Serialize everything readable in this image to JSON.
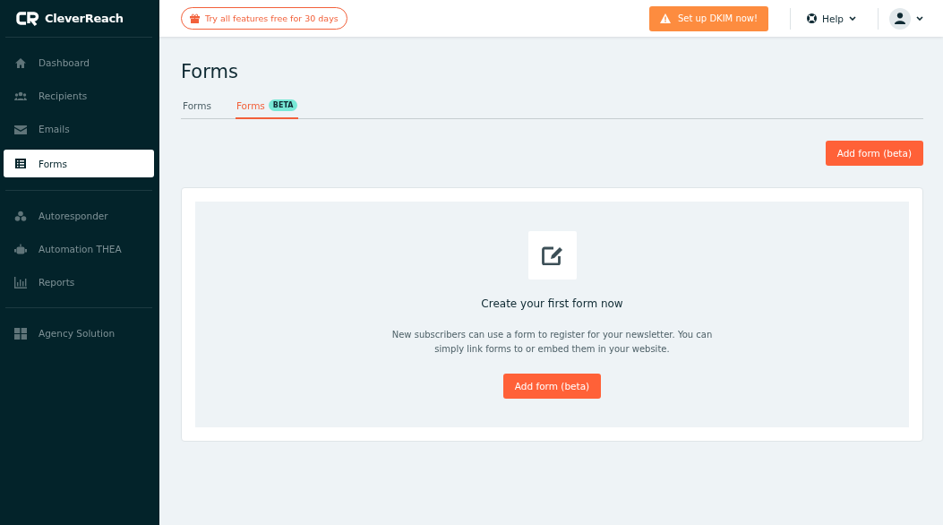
{
  "logo": {
    "text": "CleverReach"
  },
  "sidebar": {
    "groups": [
      [
        {
          "label": "Dashboard",
          "selected": false
        },
        {
          "label": "Recipients",
          "selected": false
        },
        {
          "label": "Emails",
          "selected": false
        },
        {
          "label": "Forms",
          "selected": true
        }
      ],
      [
        {
          "label": "Autoresponder",
          "selected": false
        },
        {
          "label": "Automation THEA",
          "selected": false
        },
        {
          "label": "Reports",
          "selected": false
        }
      ],
      [
        {
          "label": "Agency Solution",
          "selected": false
        }
      ]
    ]
  },
  "topbar": {
    "trial": "Try all features free for 30 days",
    "dkim": "Set up DKIM now!",
    "help": "Help"
  },
  "page": {
    "title": "Forms",
    "tabs": [
      {
        "label": "Forms",
        "selected": false
      },
      {
        "label": "Forms",
        "badge": "BETA",
        "selected": true
      }
    ],
    "add_button": "Add form (beta)",
    "empty": {
      "heading": "Create your first form now",
      "text": "New subscribers can use a form to register for your newsletter. You can simply link forms to or embed them in your website.",
      "button": "Add form (beta)"
    }
  }
}
